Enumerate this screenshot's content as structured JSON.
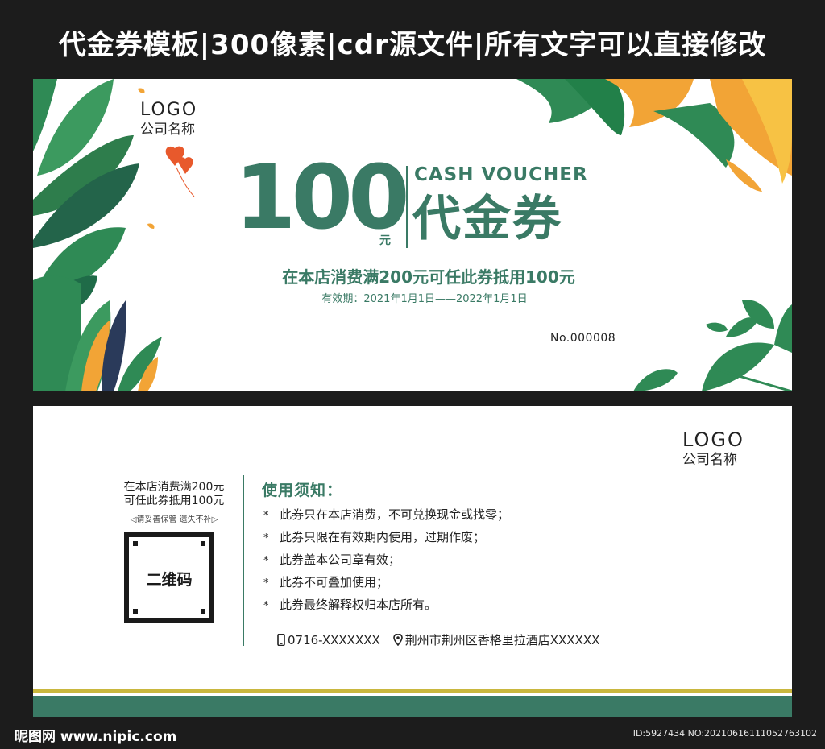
{
  "header": {
    "title": "代金券模板|300像素|cdr源文件|所有文字可以直接修改"
  },
  "front": {
    "logo": "LOGO",
    "company_name": "公司名称",
    "amount": "100",
    "amount_unit": "元",
    "cash_voucher_en": "CASH VOUCHER",
    "cash_voucher_cn": "代金券",
    "condition": "在本店消费满200元可任此券抵用100元",
    "validity": "有效期：2021年1月1日——2022年1月1日",
    "serial": "No.000008"
  },
  "back": {
    "logo": "LOGO",
    "company_name": "公司名称",
    "stub_line1": "在本店消费满200元",
    "stub_line2": "可任此券抵用100元",
    "stub_note": "◁请妥善保管  遗失不补▷",
    "qr_label": "二维码",
    "rules_title": "使用须知：",
    "rules": [
      "此券只在本店消费，不可兑换现金或找零；",
      "此券只限在有效期内使用，过期作废；",
      "此券盖本公司章有效；",
      "此券不可叠加使用；",
      "此券最终解释权归本店所有。"
    ],
    "phone": "0716-XXXXXXX",
    "address": "荆州市荆州区香格里拉酒店XXXXXX"
  },
  "footer": {
    "site": "昵图网 www.nipic.com",
    "id_text": "ID:5927434 NO:20210616111052763102"
  },
  "colors": {
    "brand_green": "#3a7a65",
    "leaf_green": "#2f8a55",
    "leaf_orange": "#f2a436",
    "gold_strip": "#c9b73e",
    "background": "#1c1c1c"
  }
}
